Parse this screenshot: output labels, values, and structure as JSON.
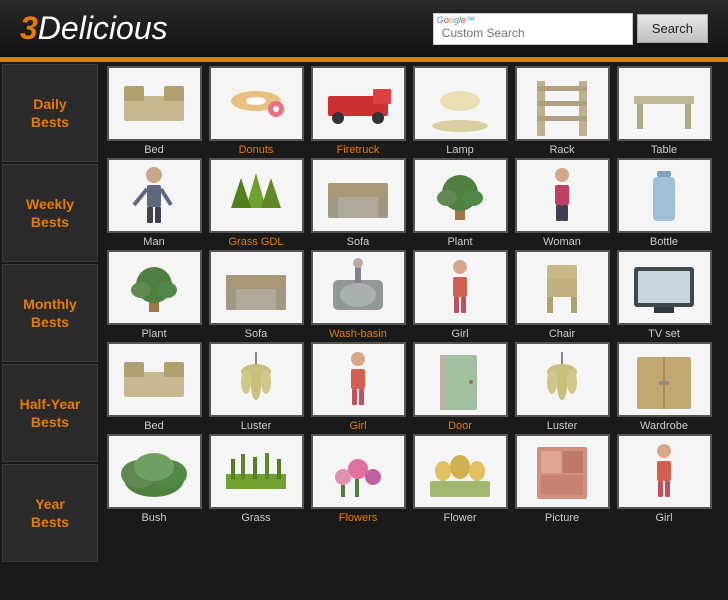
{
  "header": {
    "logo_text": "3Delicious",
    "search_placeholder": "Custom Search",
    "search_label": "Search",
    "google_label": "Google™"
  },
  "sidebar": {
    "items": [
      {
        "id": "daily",
        "label": "Daily\nBests"
      },
      {
        "id": "weekly",
        "label": "Weekly\nBests"
      },
      {
        "id": "monthly",
        "label": "Monthly\nBests"
      },
      {
        "id": "halfyear",
        "label": "Half-Year\nBests"
      },
      {
        "id": "year",
        "label": "Year\nBests"
      }
    ]
  },
  "rows": [
    {
      "items": [
        {
          "label": "Bed",
          "color": "white",
          "orange": false
        },
        {
          "label": "Donuts",
          "color": "white",
          "orange": true
        },
        {
          "label": "Firetruck",
          "color": "white",
          "orange": true
        },
        {
          "label": "Lamp",
          "color": "white",
          "orange": false
        },
        {
          "label": "Rack",
          "color": "white",
          "orange": false
        },
        {
          "label": "Table",
          "color": "white",
          "orange": false
        }
      ]
    },
    {
      "items": [
        {
          "label": "Man",
          "color": "white",
          "orange": false
        },
        {
          "label": "Grass GDL",
          "color": "white",
          "orange": true
        },
        {
          "label": "Sofa",
          "color": "white",
          "orange": false
        },
        {
          "label": "Plant",
          "color": "white",
          "orange": false
        },
        {
          "label": "Woman",
          "color": "white",
          "orange": false
        },
        {
          "label": "Bottle",
          "color": "white",
          "orange": false
        }
      ]
    },
    {
      "items": [
        {
          "label": "Plant",
          "color": "white",
          "orange": false
        },
        {
          "label": "Sofa",
          "color": "white",
          "orange": false
        },
        {
          "label": "Wash-basin",
          "color": "white",
          "orange": true
        },
        {
          "label": "Girl",
          "color": "white",
          "orange": false
        },
        {
          "label": "Chair",
          "color": "white",
          "orange": false
        },
        {
          "label": "TV set",
          "color": "white",
          "orange": false
        }
      ]
    },
    {
      "items": [
        {
          "label": "Bed",
          "color": "white",
          "orange": false
        },
        {
          "label": "Luster",
          "color": "white",
          "orange": false
        },
        {
          "label": "Girl",
          "color": "white",
          "orange": true
        },
        {
          "label": "Door",
          "color": "white",
          "orange": true
        },
        {
          "label": "Luster",
          "color": "white",
          "orange": false
        },
        {
          "label": "Wardrobe",
          "color": "white",
          "orange": false
        }
      ]
    },
    {
      "items": [
        {
          "label": "Bush",
          "color": "white",
          "orange": false
        },
        {
          "label": "Grass",
          "color": "white",
          "orange": false
        },
        {
          "label": "Flowers",
          "color": "white",
          "orange": true
        },
        {
          "label": "Flower",
          "color": "white",
          "orange": false
        },
        {
          "label": "Picture",
          "color": "white",
          "orange": false
        },
        {
          "label": "Girl",
          "color": "white",
          "orange": false
        }
      ]
    }
  ],
  "thumbnails": {
    "colors": {
      "Bed": "#d4c4a0",
      "Donuts": "#e8a0c0",
      "Firetruck": "#c04040",
      "Lamp": "#e8e0a0",
      "Rack": "#d8c8a8",
      "Table": "#c8c0b0",
      "Man": "#c0a888",
      "Grass GDL": "#80a850",
      "Sofa": "#b8b0a0",
      "Plant": "#70a860",
      "Woman": "#d0a888",
      "Bottle": "#a0b8d0",
      "Wash-basin": "#908888",
      "Girl": "#c8a888",
      "Chair": "#c0b090",
      "TV set": "#606870",
      "Luster": "#b0a878",
      "Door": "#a8c0a0",
      "Wardrobe": "#b8a878",
      "Bush": "#70a050",
      "Grass": "#80b050",
      "Flowers": "#e070a0",
      "Flower": "#90b870",
      "Picture": "#d09080"
    }
  }
}
